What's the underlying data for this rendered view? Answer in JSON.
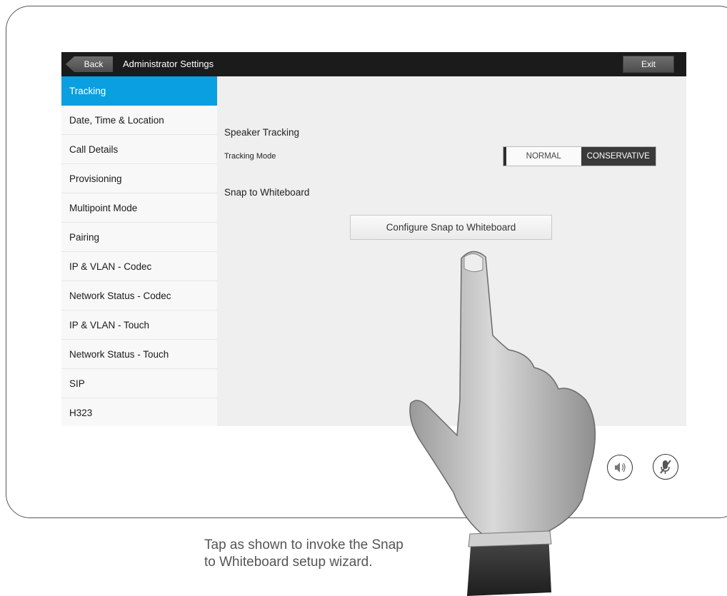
{
  "topbar": {
    "back_label": "Back",
    "title": "Administrator Settings",
    "exit_label": "Exit"
  },
  "sidebar": {
    "items": [
      {
        "label": "Tracking",
        "active": true
      },
      {
        "label": "Date, Time & Location"
      },
      {
        "label": "Call Details"
      },
      {
        "label": "Provisioning"
      },
      {
        "label": "Multipoint Mode"
      },
      {
        "label": "Pairing"
      },
      {
        "label": "IP & VLAN - Codec"
      },
      {
        "label": "Network Status - Codec"
      },
      {
        "label": "IP & VLAN - Touch"
      },
      {
        "label": "Network Status - Touch"
      },
      {
        "label": "SIP"
      },
      {
        "label": "H323"
      }
    ]
  },
  "main": {
    "speaker_tracking_title": "Speaker Tracking",
    "tracking_mode_label": "Tracking Mode",
    "mode_options": [
      "NORMAL",
      "CONSERVATIVE"
    ],
    "selected_mode": "CONSERVATIVE",
    "snap_title": "Snap to Whiteboard",
    "configure_button": "Configure Snap to Whiteboard"
  },
  "device_controls": {
    "volume_icon": "speaker-volume-icon",
    "mute_icon": "microphone-mute-icon"
  },
  "caption": {
    "line1": "Tap as shown to invoke the Snap",
    "line2": "to Whiteboard setup wizard."
  },
  "colors": {
    "accent": "#0a9fe0",
    "topbar": "#1b1b1b",
    "selected_toggle": "#3a3a3a"
  }
}
